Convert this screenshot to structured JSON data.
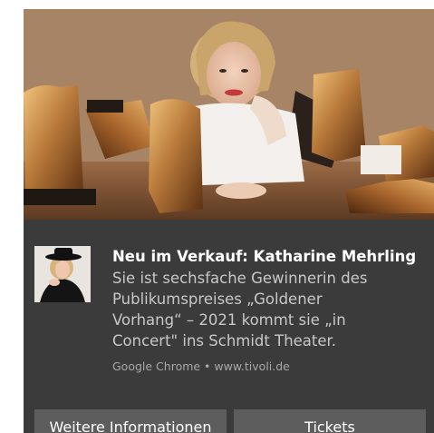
{
  "notification": {
    "title": "Neu im Verkauf: Katharine Mehrling",
    "message_lines": [
      "Sie ist sechsfache Gewinnerin des",
      "Publikumspreises „Goldener",
      "Vorhang“ – 2021 kommt sie „in",
      "Concert\" ins Schmidt Theater."
    ],
    "attribution": "Google Chrome • www.tivoli.de",
    "hero_image": "hero-photo",
    "app_icon": "artist-avatar"
  },
  "actions": [
    {
      "label": "Weitere Informationen"
    },
    {
      "label": "Tickets"
    }
  ],
  "colors": {
    "toast_background": "#3b3b3b",
    "button_background": "#5d5d5d",
    "title_text": "#ffffff",
    "message_text": "#c8c8c8",
    "attribution_text": "#a8a8a8",
    "gold_sculpture": "#b8793a"
  }
}
